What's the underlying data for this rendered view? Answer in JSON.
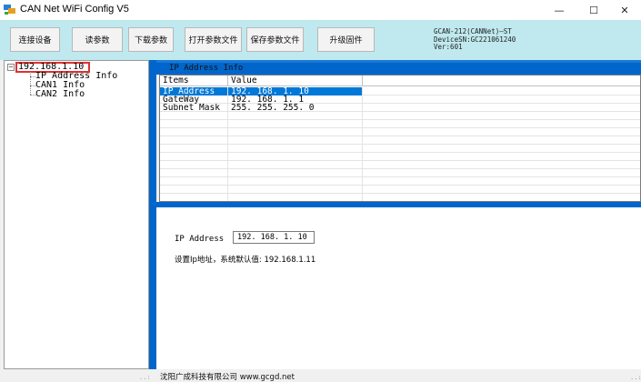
{
  "window": {
    "title": "CAN Net WiFi Config V5",
    "minimize_glyph": "—",
    "maximize_glyph": "☐",
    "close_glyph": "✕",
    "app_icon": "network-config-icon"
  },
  "toolbar": {
    "connect_label": "连接设备",
    "read_label": "读参数",
    "download_label": "下载参数",
    "open_label": "打开参数文件",
    "save_label": "保存参数文件",
    "upgrade_label": "升级固件",
    "device_model": "GCAN-212(CANNet)—ST",
    "device_sn": "DeviceSN:GC221061240",
    "device_ver": "Ver:601"
  },
  "tree": {
    "root": "192.168.1.10",
    "expander": "−",
    "children": [
      "IP Address Info",
      "CAN1 Info",
      "CAN2 Info"
    ]
  },
  "panel": {
    "title": "IP Address Info",
    "columns": [
      "Items",
      "Value"
    ],
    "rows": [
      [
        "IP Address",
        "192. 168. 1. 10"
      ],
      [
        "GateWay",
        "192. 168. 1. 1"
      ],
      [
        "Subnet Mask",
        "255. 255. 255. 0"
      ]
    ]
  },
  "form": {
    "label": "IP Address",
    "value": "192. 168. 1. 10",
    "description": "设置Ip地址，系统默认值: 192.168.1.11"
  },
  "status": {
    "text": "沈阳广成科技有限公司  www.gcgd.net",
    "grip": "..:"
  },
  "colors": {
    "toolbar_bg": "#bfe9ee",
    "accent_blue": "#0066cc",
    "selection": "#0078d7",
    "highlight_border": "#e03030"
  }
}
